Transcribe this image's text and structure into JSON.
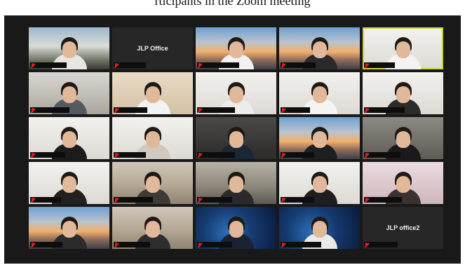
{
  "caption": {
    "text": "rticipants in the Zoom meeting"
  },
  "tiles": [
    {
      "label": "",
      "bg": "bg-cherry",
      "shirt": "#e8e6e2",
      "active": false
    },
    {
      "label": "JLP Office",
      "bg": "",
      "shirt": "",
      "active": false
    },
    {
      "label": "",
      "bg": "bg-sunset",
      "shirt": "#f1f1f1",
      "active": false
    },
    {
      "label": "",
      "bg": "bg-sunset",
      "shirt": "#2a2a2a",
      "active": false
    },
    {
      "label": "",
      "bg": "bg-white",
      "shirt": "#f3f3f3",
      "active": true
    },
    {
      "label": "",
      "bg": "bg-office",
      "shirt": "#555a60",
      "active": false
    },
    {
      "label": "",
      "bg": "bg-warm",
      "shirt": "#f2f2f2",
      "active": false
    },
    {
      "label": "",
      "bg": "bg-white",
      "shirt": "#ececec",
      "active": false
    },
    {
      "label": "",
      "bg": "bg-white",
      "shirt": "#f4f4f4",
      "active": false
    },
    {
      "label": "",
      "bg": "bg-white",
      "shirt": "#2b2b2b",
      "active": false
    },
    {
      "label": "",
      "bg": "bg-white",
      "shirt": "#1c1c1c",
      "active": false
    },
    {
      "label": "",
      "bg": "bg-white",
      "shirt": "#cfc9bf",
      "active": false
    },
    {
      "label": "",
      "bg": "bg-dark",
      "shirt": "#1b2738",
      "active": false
    },
    {
      "label": "",
      "bg": "bg-sunset",
      "shirt": "#1f1f1f",
      "active": false
    },
    {
      "label": "",
      "bg": "bg-dim",
      "shirt": "#1a1a1a",
      "active": false
    },
    {
      "label": "",
      "bg": "bg-white",
      "shirt": "#23211f",
      "active": false
    },
    {
      "label": "",
      "bg": "bg-room",
      "shirt": "#3e3a36",
      "active": false
    },
    {
      "label": "",
      "bg": "bg-shelf",
      "shirt": "#2a2a2a",
      "active": false
    },
    {
      "label": "",
      "bg": "bg-white",
      "shirt": "#1f1f1f",
      "active": false
    },
    {
      "label": "",
      "bg": "bg-pink",
      "shirt": "#3a3230",
      "active": false
    },
    {
      "label": "",
      "bg": "bg-sunset",
      "shirt": "#2b2b2b",
      "active": false
    },
    {
      "label": "",
      "bg": "bg-room",
      "shirt": "#2d2d2d",
      "active": false
    },
    {
      "label": "",
      "bg": "bg-blue",
      "shirt": "#1a2233",
      "active": false
    },
    {
      "label": "",
      "bg": "bg-blue",
      "shirt": "#eaeaea",
      "active": false
    },
    {
      "label": "JLP office2",
      "bg": "",
      "shirt": "",
      "active": false
    }
  ],
  "colors": {
    "active_border": "#c9d631",
    "muted_mic": "#e02020",
    "window_bg": "#191919"
  },
  "icons": {
    "muted": "muted-mic-icon"
  }
}
